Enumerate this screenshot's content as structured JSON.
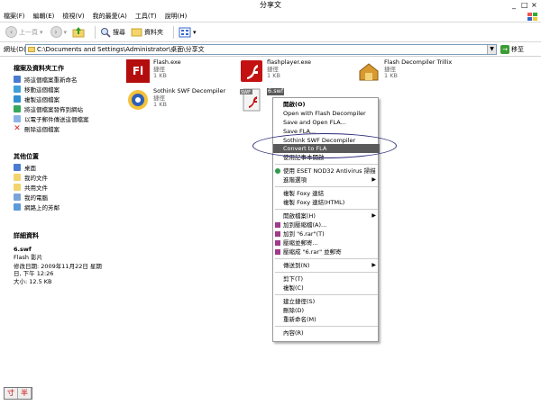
{
  "window": {
    "title": "分享文"
  },
  "menubar": {
    "items": [
      "檔案(F)",
      "編輯(E)",
      "檢視(V)",
      "我的最愛(A)",
      "工具(T)",
      "說明(H)"
    ]
  },
  "toolbar": {
    "back": "上一頁",
    "search": "搜尋",
    "folders": "資料夾"
  },
  "address": {
    "label": "網址(D)",
    "value": "C:\\Documents and Settings\\Administrator\\桌面\\分享文",
    "go": "移至"
  },
  "sidebar": {
    "tasks_title": "檔案及資料夾工作",
    "tasks": [
      "將這個檔案重新命名",
      "移動這個檔案",
      "複製這個檔案",
      "將這個檔案發佈到網站",
      "以電子郵件傳送這個檔案",
      "刪除這個檔案"
    ],
    "places_title": "其他位置",
    "places": [
      "桌面",
      "我的文件",
      "共用文件",
      "我的電腦",
      "網路上的芳鄰"
    ],
    "details_title": "詳細資料",
    "details": {
      "name": "6.swf",
      "type": "Flash 影片",
      "modified": "修改日期: 2009年11月22日 星期日, 下午 12:26",
      "size": "大小: 12.5 KB"
    }
  },
  "files": [
    {
      "name": "Flash.exe",
      "kind": "捷徑",
      "size": "1 KB"
    },
    {
      "name": "flashplayer.exe",
      "kind": "捷徑",
      "size": "1 KB"
    },
    {
      "name": "Flash Decompiler Trillix",
      "kind": "捷徑",
      "size": "1 KB"
    },
    {
      "name": "Sothink SWF Decompiler",
      "kind": "捷徑",
      "size": "1 KB"
    },
    {
      "name": "6.swf",
      "kind": "",
      "size": ""
    }
  ],
  "context_menu": {
    "items": [
      "開啟(O)",
      "Open with Flash Decompiler",
      "Save and Open FLA...",
      "Save FLA...",
      "Sothink SWF Decompiler",
      "Convert to FLA",
      "使用記事本開啟",
      "使用 ESET NOD32 Antivirus 掃描",
      "進階選項",
      "複製 Foxy 連結",
      "複製 Foxy 連結(HTML)",
      "開啟檔案(H)",
      "加到壓縮檔(A)...",
      "加到 \"6.rar\"(T)",
      "壓縮並郵寄...",
      "壓縮成 \"6.rar\" 並郵寄",
      "傳送到(N)",
      "剪下(T)",
      "複製(C)",
      "建立捷徑(S)",
      "刪除(D)",
      "重新命名(M)",
      "內容(R)"
    ]
  },
  "ime": {
    "a": "寸",
    "b": "半"
  }
}
